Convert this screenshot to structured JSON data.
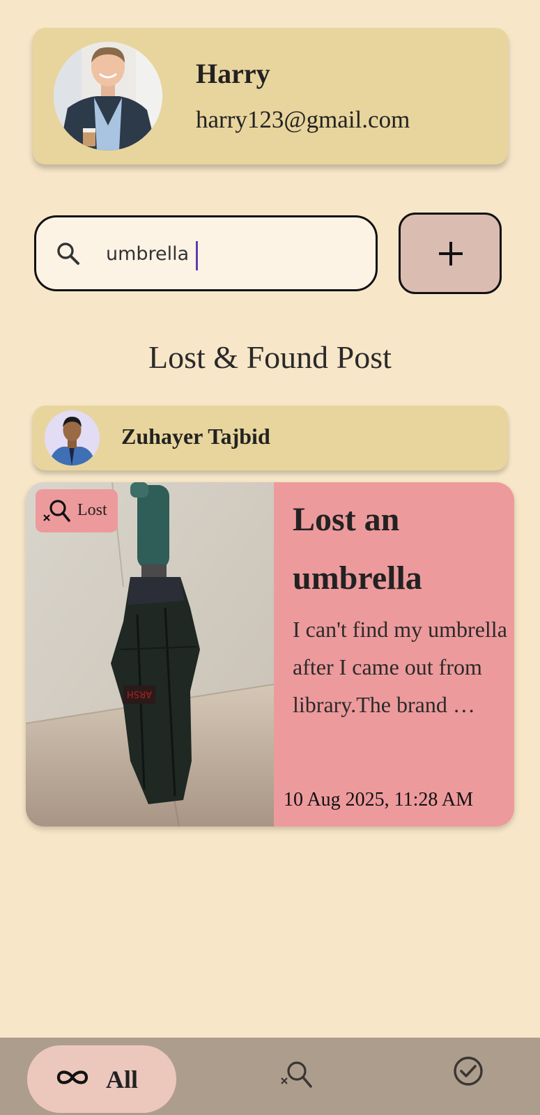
{
  "profile": {
    "name": "Harry",
    "email": "harry123@gmail.com"
  },
  "search": {
    "value": "umbrella",
    "placeholder": ""
  },
  "add_button": {
    "icon": "plus-icon"
  },
  "section": {
    "title": "Lost & Found Post"
  },
  "posts": [
    {
      "author": "Zuhayer Tajbid",
      "status": "Lost",
      "title": "Lost an umbrella",
      "description": "I can't find my umbrella after I came out from library.The brand …",
      "date": "10 Aug 2025, 11:28 AM",
      "image_text": "ARSH"
    }
  ],
  "nav": {
    "all_label": "All",
    "active": "all",
    "icons": [
      "infinity-icon",
      "lost-search-icon",
      "found-check-icon"
    ]
  },
  "colors": {
    "background": "#f7e6c8",
    "card": "#e8d59d",
    "lost": "#ed9a9c",
    "add_button": "#dbbcb1",
    "nav_bar": "#ad9d8d",
    "nav_active": "#ecc7bc"
  }
}
